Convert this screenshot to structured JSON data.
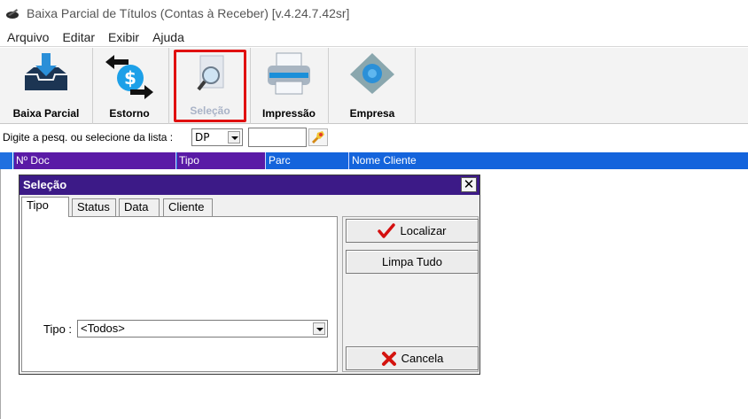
{
  "window": {
    "title": "Baixa Parcial de Títulos (Contas à Receber) [v.4.24.7.42sr]"
  },
  "menu": {
    "items": [
      "Arquivo",
      "Editar",
      "Exibir",
      "Ajuda"
    ]
  },
  "toolbar": {
    "baixa_parcial": "Baixa Parcial",
    "estorno": "Estorno",
    "selecao": "Seleção",
    "impressao": "Impressão",
    "empresa": "Empresa"
  },
  "search": {
    "label": "Digite a pesq. ou selecione da lista :",
    "combo_value": "DP",
    "input_value": ""
  },
  "grid": {
    "columns": [
      "Nº Doc",
      "Tipo",
      "Parc",
      "Nome Cliente"
    ]
  },
  "dialog": {
    "title": "Seleção",
    "close": "✕",
    "tabs": [
      "Tipo",
      "Status",
      "Data",
      "Cliente"
    ],
    "tipo_label": "Tipo :",
    "tipo_value": "<Todos>",
    "buttons": {
      "localizar": "Localizar",
      "limpa_tudo": "Limpa Tudo",
      "cancela": "Cancela"
    }
  },
  "colors": {
    "header_blue": "#1464dc",
    "header_purple": "#5a1aa6",
    "dialog_title": "#3c1a87",
    "selection_border": "#e01010"
  }
}
